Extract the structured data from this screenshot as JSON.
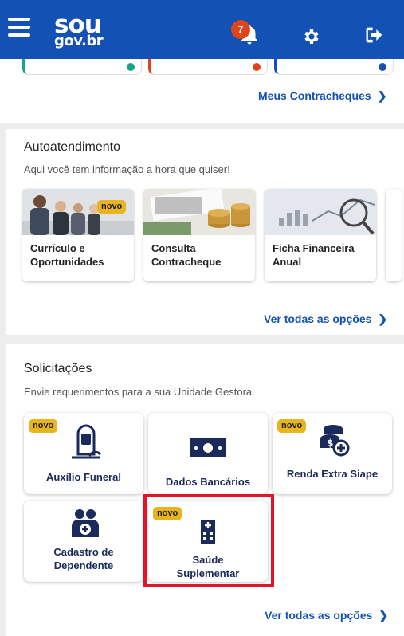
{
  "header": {
    "logo_line1": "sou",
    "logo_line2": "gov.br",
    "notification_count": "7"
  },
  "top": {
    "link": "Meus Contracheques"
  },
  "autoatendimento": {
    "title": "Autoatendimento",
    "subtitle": "Aqui você tem informação a hora que quiser!",
    "badge": "novo",
    "cards": [
      {
        "label": "Currículo e Oportunidades"
      },
      {
        "label": "Consulta Contracheque"
      },
      {
        "label": "Ficha Financeira Anual"
      }
    ],
    "link": "Ver todas as opções"
  },
  "solicitacoes": {
    "title": "Solicitações",
    "subtitle": "Envie requerimentos para a sua Unidade Gestora.",
    "badge": "novo",
    "cards": [
      {
        "label": "Auxílio Funeral"
      },
      {
        "label": "Dados Bancários"
      },
      {
        "label": "Renda Extra Siape"
      },
      {
        "label": "Cadastro de Dependente"
      },
      {
        "label": "Saúde Suplementar"
      }
    ],
    "link": "Ver todas as opções"
  },
  "colors": {
    "primary": "#1351b4",
    "badge": "#e8b420",
    "highlight": "#e3132a",
    "notification": "#e0441b"
  }
}
